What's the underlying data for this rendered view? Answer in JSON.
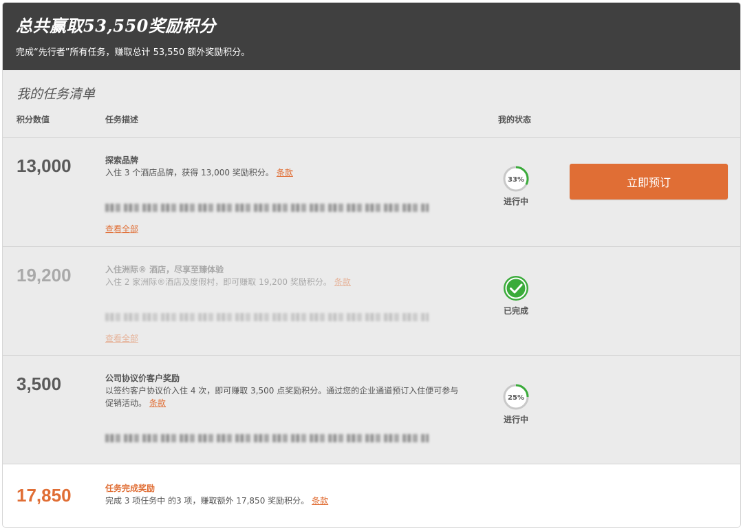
{
  "header": {
    "title": "总共赢取53,550奖励积分",
    "subtitle": "完成“先行者”所有任务，赚取总计 53,550 额外奖励积分。"
  },
  "list": {
    "title": "我的任务清单",
    "columns": {
      "points": "积分数值",
      "description": "任务描述",
      "status": "我的状态"
    }
  },
  "tasks": [
    {
      "points": "13,000",
      "title": "探索品牌",
      "description": "入住 3 个酒店品牌，获得 13,000 奖励积分。",
      "terms": "条款",
      "view_all": "查看全部",
      "progress_label": "33%",
      "progress": 0.33,
      "status": "进行中",
      "button": "立即预订",
      "completed": false
    },
    {
      "points": "19,200",
      "title": "入住洲际® 酒店，尽享至臻体验",
      "description": "入住 2 家洲际®酒店及度假村，即可赚取 19,200 奖励积分。",
      "terms": "条款",
      "view_all": "查看全部",
      "status": "已完成",
      "completed": true
    },
    {
      "points": "3,500",
      "title": "公司协议价客户奖励",
      "description": "以签约客户协议价入住 4 次，即可赚取 3,500 点奖励积分。通过您的企业通道预订入住便可参与促销活动。",
      "terms": "条款",
      "progress_label": "25%",
      "progress": 0.25,
      "status": "进行中",
      "completed": false
    },
    {
      "points": "17,850",
      "title": "任务完成奖励",
      "description": "完成 3 项任务中 的3 项，赚取额外 17,850 奖励积分。",
      "terms": "条款"
    }
  ],
  "colors": {
    "accent": "#e06e35",
    "header_bg": "#404040",
    "progress_green": "#3aab3a",
    "track_grey": "#c8c8c8"
  }
}
